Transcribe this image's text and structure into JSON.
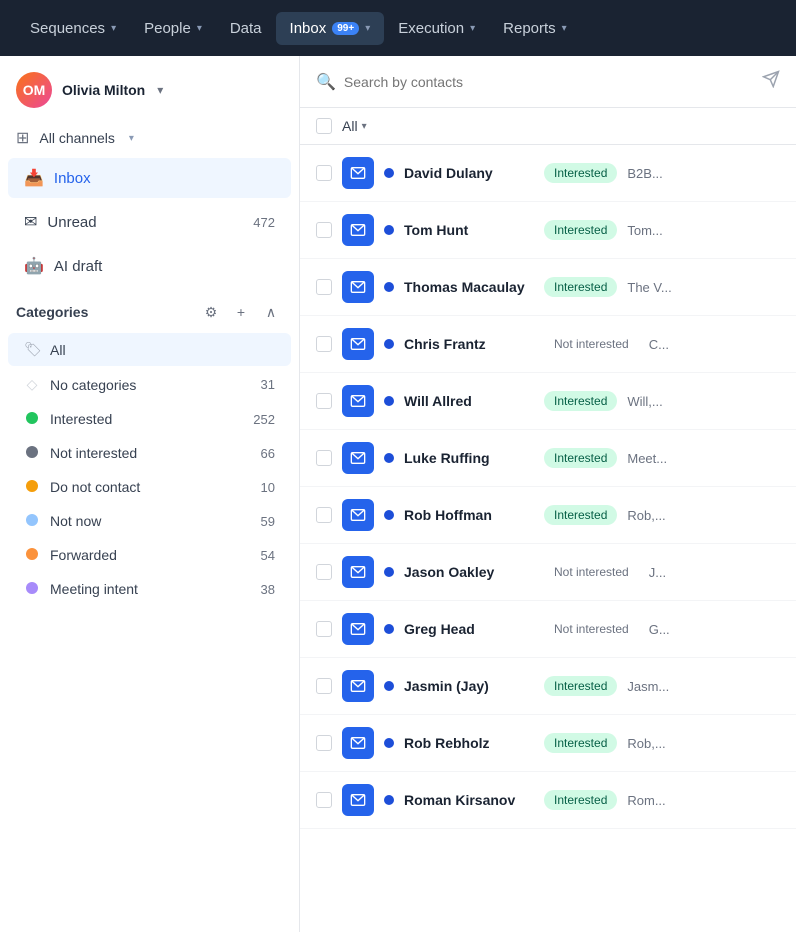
{
  "nav": {
    "items": [
      {
        "label": "Sequences",
        "hasChevron": true,
        "active": false
      },
      {
        "label": "People",
        "hasChevron": true,
        "active": false
      },
      {
        "label": "Data",
        "hasChevron": false,
        "active": false
      },
      {
        "label": "Inbox",
        "hasChevron": true,
        "active": true,
        "badge": "99+"
      },
      {
        "label": "Execution",
        "hasChevron": true,
        "active": false
      },
      {
        "label": "Reports",
        "hasChevron": true,
        "active": false
      }
    ]
  },
  "sidebar": {
    "user": {
      "name": "Olivia Milton",
      "initials": "OM"
    },
    "channel": {
      "label": "All channels"
    },
    "nav": [
      {
        "label": "Inbox",
        "icon": "inbox",
        "active": true,
        "count": null
      },
      {
        "label": "Unread",
        "icon": "mail",
        "active": false,
        "count": "472"
      },
      {
        "label": "AI draft",
        "icon": "ai",
        "active": false,
        "count": null
      }
    ],
    "categories_title": "Categories",
    "categories": [
      {
        "label": "All",
        "color": "#9ca3af",
        "count": null,
        "active": true,
        "type": "tag"
      },
      {
        "label": "No categories",
        "color": "#d1d5db",
        "count": "31",
        "active": false,
        "type": "diamond"
      },
      {
        "label": "Interested",
        "color": "#22c55e",
        "count": "252",
        "active": false,
        "type": "dot"
      },
      {
        "label": "Not interested",
        "color": "#6b7280",
        "count": "66",
        "active": false,
        "type": "dot"
      },
      {
        "label": "Do not contact",
        "color": "#f59e0b",
        "count": "10",
        "active": false,
        "type": "dot"
      },
      {
        "label": "Not now",
        "color": "#93c5fd",
        "count": "59",
        "active": false,
        "type": "dot"
      },
      {
        "label": "Forwarded",
        "color": "#fb923c",
        "count": "54",
        "active": false,
        "type": "dot"
      },
      {
        "label": "Meeting intent",
        "color": "#a78bfa",
        "count": "38",
        "active": false,
        "type": "dot"
      }
    ]
  },
  "search": {
    "placeholder": "Search by contacts"
  },
  "list_header": {
    "all_label": "All"
  },
  "contacts": [
    {
      "name": "David Dulany",
      "status": "Interested",
      "status_type": "interested",
      "preview": "B2B..."
    },
    {
      "name": "Tom Hunt",
      "status": "Interested",
      "status_type": "interested",
      "preview": "Tom..."
    },
    {
      "name": "Thomas Macaulay",
      "status": "Interested",
      "status_type": "interested",
      "preview": "The V..."
    },
    {
      "name": "Chris Frantz",
      "status": "Not interested",
      "status_type": "not-interested",
      "preview": "C..."
    },
    {
      "name": "Will Allred",
      "status": "Interested",
      "status_type": "interested",
      "preview": "Will,..."
    },
    {
      "name": "Luke Ruffing",
      "status": "Interested",
      "status_type": "interested",
      "preview": "Meet..."
    },
    {
      "name": "Rob Hoffman",
      "status": "Interested",
      "status_type": "interested",
      "preview": "Rob,..."
    },
    {
      "name": "Jason Oakley",
      "status": "Not interested",
      "status_type": "not-interested",
      "preview": "J..."
    },
    {
      "name": "Greg Head",
      "status": "Not interested",
      "status_type": "not-interested",
      "preview": "G..."
    },
    {
      "name": "Jasmin (Jay)",
      "status": "Interested",
      "status_type": "interested",
      "preview": "Jasm..."
    },
    {
      "name": "Rob Rebholz",
      "status": "Interested",
      "status_type": "interested",
      "preview": "Rob,..."
    },
    {
      "name": "Roman Kirsanov",
      "status": "Interested",
      "status_type": "interested",
      "preview": "Rom..."
    }
  ]
}
